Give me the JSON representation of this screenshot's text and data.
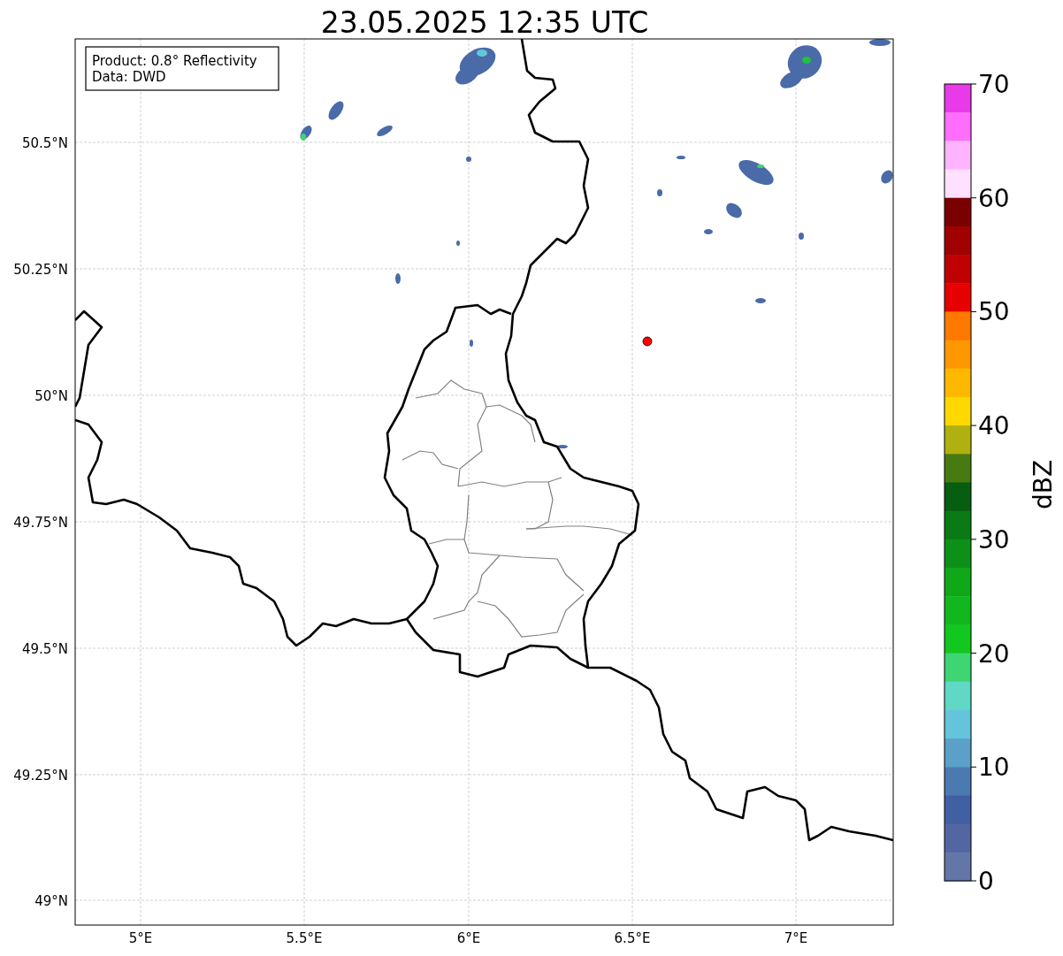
{
  "title": "23.05.2025 12:35 UTC",
  "info_box": {
    "lines": [
      "Product: 0.8° Reflectivity",
      "Data: DWD"
    ]
  },
  "map": {
    "x_ticks": [
      "5°E",
      "5.5°E",
      "6°E",
      "6.5°E",
      "7°E"
    ],
    "y_ticks": [
      "50.5°N",
      "50.25°N",
      "50°N",
      "49.75°N",
      "49.5°N",
      "49.25°N",
      "49°N"
    ]
  },
  "colorbar": {
    "label": "dBZ",
    "ticks": [
      "70",
      "60",
      "50",
      "40",
      "30",
      "20",
      "10",
      "0"
    ],
    "bins": [
      {
        "color": "#e83ae8"
      },
      {
        "color": "#ff6eff"
      },
      {
        "color": "#ffb4ff"
      },
      {
        "color": "#ffe0ff"
      },
      {
        "color": "#7a0000"
      },
      {
        "color": "#a00000"
      },
      {
        "color": "#c00000"
      },
      {
        "color": "#e60000"
      },
      {
        "color": "#ff7800"
      },
      {
        "color": "#ff9800"
      },
      {
        "color": "#ffb800"
      },
      {
        "color": "#ffd800"
      },
      {
        "color": "#b0b010"
      },
      {
        "color": "#477a10"
      },
      {
        "color": "#065e10"
      },
      {
        "color": "#0a7a14"
      },
      {
        "color": "#0d9018"
      },
      {
        "color": "#0fa818"
      },
      {
        "color": "#10b81e"
      },
      {
        "color": "#12c81e"
      },
      {
        "color": "#3dd672"
      },
      {
        "color": "#5fd9c4"
      },
      {
        "color": "#64c4dc"
      },
      {
        "color": "#5aa0c8"
      },
      {
        "color": "#4a7ab0"
      },
      {
        "color": "#4060a3"
      },
      {
        "color": "#5366a2"
      },
      {
        "color": "#6476a8"
      }
    ]
  }
}
